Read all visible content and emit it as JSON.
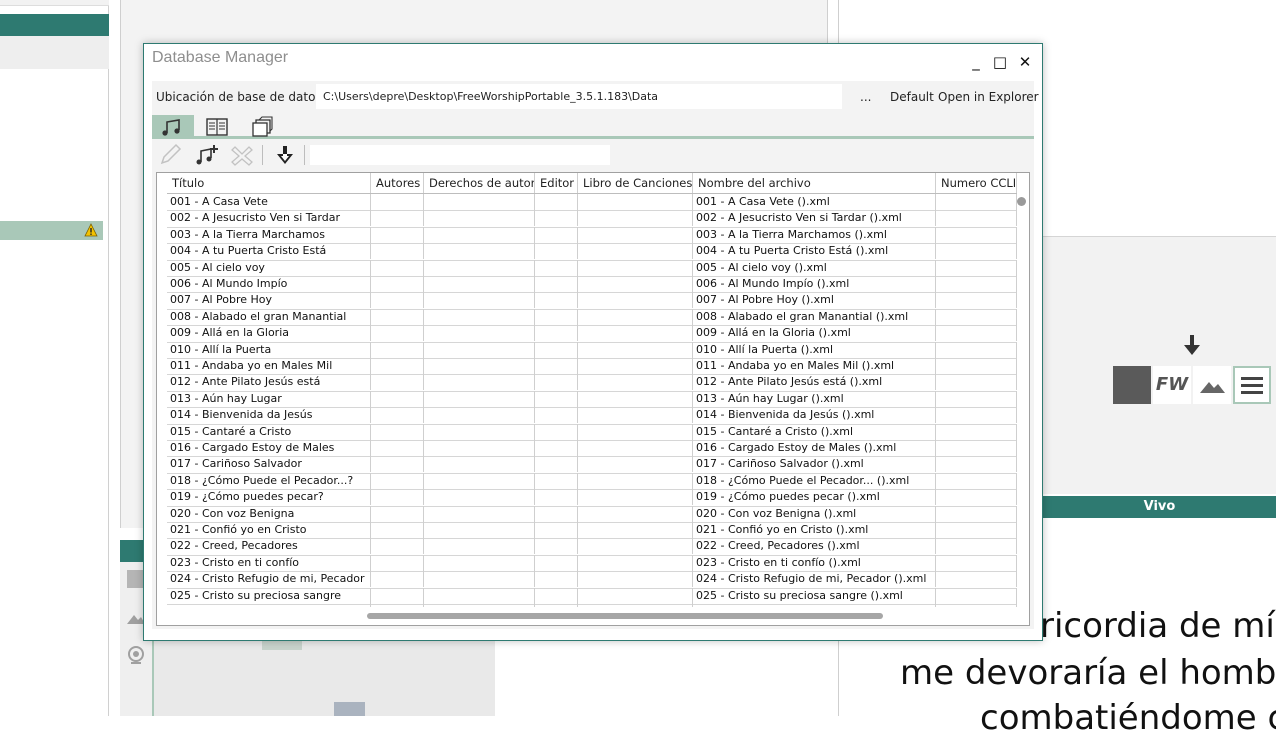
{
  "dialog": {
    "title": "Database Manager",
    "minimize_glyph": "_",
    "maximize_glyph": "□",
    "close_glyph": "✕",
    "location_label": "Ubicación de base de datos",
    "location_path": "C:\\Users\\depre\\Desktop\\FreeWorshipPortable_3.5.1.183\\Data",
    "browse_label": "...",
    "default_label": "Default",
    "open_explorer_label": "Open in Explorer",
    "tabs": [
      {
        "name": "songs-tab",
        "icon": "music-note-icon",
        "active": true
      },
      {
        "name": "bible-tab",
        "icon": "book-icon",
        "active": false
      },
      {
        "name": "media-tab",
        "icon": "pages-icon",
        "active": false
      }
    ],
    "toolbar_icons": [
      "edit-pencil-icon",
      "add-song-icon",
      "delete-icon",
      "import-down-arrow-icon"
    ],
    "search_value": ""
  },
  "table": {
    "columns": [
      "Título",
      "Autores",
      "Derechos de autor",
      "Editor",
      "Libro de Canciones",
      "Nombre del archivo",
      "Numero CCLI"
    ],
    "rows": [
      [
        "001 - A Casa Vete",
        "",
        "",
        "",
        "",
        "001 - A Casa Vete ().xml",
        ""
      ],
      [
        "002 - A Jesucristo Ven si Tardar",
        "",
        "",
        "",
        "",
        "002 - A Jesucristo Ven si Tardar ().xml",
        ""
      ],
      [
        "003 - A la Tierra Marchamos",
        "",
        "",
        "",
        "",
        "003 - A la Tierra Marchamos ().xml",
        ""
      ],
      [
        "004 - A tu Puerta Cristo Está",
        "",
        "",
        "",
        "",
        "004 - A tu Puerta Cristo Está ().xml",
        ""
      ],
      [
        "005 - Al cielo voy",
        "",
        "",
        "",
        "",
        "005 - Al cielo voy ().xml",
        ""
      ],
      [
        "006 - Al Mundo Impío",
        "",
        "",
        "",
        "",
        "006 - Al Mundo Impío ().xml",
        ""
      ],
      [
        "007 - Al Pobre Hoy",
        "",
        "",
        "",
        "",
        "007 - Al Pobre Hoy ().xml",
        ""
      ],
      [
        "008 - Alabado el gran Manantial",
        "",
        "",
        "",
        "",
        "008 - Alabado el gran Manantial ().xml",
        ""
      ],
      [
        "009 - Allá en la Gloria",
        "",
        "",
        "",
        "",
        "009 - Allá en la Gloria ().xml",
        ""
      ],
      [
        "010 - Allí la Puerta",
        "",
        "",
        "",
        "",
        "010 - Allí la Puerta ().xml",
        ""
      ],
      [
        "011 - Andaba yo en Males Mil",
        "",
        "",
        "",
        "",
        "011 - Andaba yo en Males Mil ().xml",
        ""
      ],
      [
        "012 - Ante Pilato Jesús está",
        "",
        "",
        "",
        "",
        "012 - Ante Pilato Jesús está ().xml",
        ""
      ],
      [
        "013 - Aún hay Lugar",
        "",
        "",
        "",
        "",
        "013 - Aún hay Lugar ().xml",
        ""
      ],
      [
        "014 - Bienvenida da Jesús",
        "",
        "",
        "",
        "",
        "014 - Bienvenida da Jesús ().xml",
        ""
      ],
      [
        "015 - Cantaré a Cristo",
        "",
        "",
        "",
        "",
        "015 - Cantaré a Cristo ().xml",
        ""
      ],
      [
        "016 - Cargado Estoy de Males",
        "",
        "",
        "",
        "",
        "016 - Cargado Estoy de Males ().xml",
        ""
      ],
      [
        "017 - Cariñoso Salvador",
        "",
        "",
        "",
        "",
        "017 - Cariñoso Salvador ().xml",
        ""
      ],
      [
        "018 - ¿Cómo Puede el Pecador...?",
        "",
        "",
        "",
        "",
        "018 - ¿Cómo Puede el Pecador... ().xml",
        ""
      ],
      [
        "019 - ¿Cómo puedes pecar?",
        "",
        "",
        "",
        "",
        "019 - ¿Cómo puedes pecar ().xml",
        ""
      ],
      [
        "020 - Con voz Benigna",
        "",
        "",
        "",
        "",
        "020 - Con voz Benigna ().xml",
        ""
      ],
      [
        "021 - Confió yo en Cristo",
        "",
        "",
        "",
        "",
        "021 - Confió yo en Cristo ().xml",
        ""
      ],
      [
        "022 - Creed, Pecadores",
        "",
        "",
        "",
        "",
        "022 - Creed, Pecadores ().xml",
        ""
      ],
      [
        "023 - Cristo en ti confío",
        "",
        "",
        "",
        "",
        "023 - Cristo en ti confío ().xml",
        ""
      ],
      [
        "024 - Cristo Refugio de mi, Pecador",
        "",
        "",
        "",
        "",
        "024 - Cristo Refugio de mi, Pecador ().xml",
        ""
      ],
      [
        "025 - Cristo su preciosa sangre",
        "",
        "",
        "",
        "",
        "025 - Cristo su preciosa sangre ().xml",
        ""
      ]
    ]
  },
  "background": {
    "vivo_label": "Vivo",
    "fw_label": "FW",
    "preview_lines": [
      "ricordia de mí,",
      "me devoraría el hombre",
      "combatiéndome c"
    ],
    "accent_color": "#2e7a71",
    "highlight_color": "#a9c8b8"
  }
}
